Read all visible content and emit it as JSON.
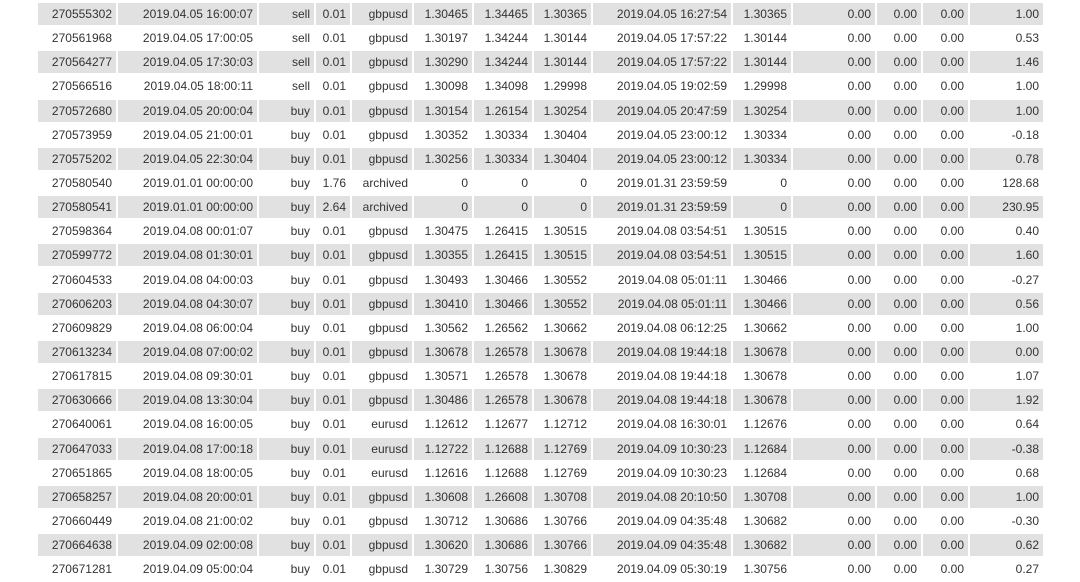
{
  "colors": {
    "alt_row": "#e1e1e1",
    "text": "#333333"
  },
  "rows": [
    [
      "270555302",
      "2019.04.05 16:00:07",
      "sell",
      "0.01",
      "gbpusd",
      "1.30465",
      "1.34465",
      "1.30365",
      "2019.04.05 16:27:54",
      "1.30365",
      "0.00",
      "0.00",
      "0.00",
      "1.00"
    ],
    [
      "270561968",
      "2019.04.05 17:00:05",
      "sell",
      "0.01",
      "gbpusd",
      "1.30197",
      "1.34244",
      "1.30144",
      "2019.04.05 17:57:22",
      "1.30144",
      "0.00",
      "0.00",
      "0.00",
      "0.53"
    ],
    [
      "270564277",
      "2019.04.05 17:30:03",
      "sell",
      "0.01",
      "gbpusd",
      "1.30290",
      "1.34244",
      "1.30144",
      "2019.04.05 17:57:22",
      "1.30144",
      "0.00",
      "0.00",
      "0.00",
      "1.46"
    ],
    [
      "270566516",
      "2019.04.05 18:00:11",
      "sell",
      "0.01",
      "gbpusd",
      "1.30098",
      "1.34098",
      "1.29998",
      "2019.04.05 19:02:59",
      "1.29998",
      "0.00",
      "0.00",
      "0.00",
      "1.00"
    ],
    [
      "270572680",
      "2019.04.05 20:00:04",
      "buy",
      "0.01",
      "gbpusd",
      "1.30154",
      "1.26154",
      "1.30254",
      "2019.04.05 20:47:59",
      "1.30254",
      "0.00",
      "0.00",
      "0.00",
      "1.00"
    ],
    [
      "270573959",
      "2019.04.05 21:00:01",
      "buy",
      "0.01",
      "gbpusd",
      "1.30352",
      "1.30334",
      "1.30404",
      "2019.04.05 23:00:12",
      "1.30334",
      "0.00",
      "0.00",
      "0.00",
      "-0.18"
    ],
    [
      "270575202",
      "2019.04.05 22:30:04",
      "buy",
      "0.01",
      "gbpusd",
      "1.30256",
      "1.30334",
      "1.30404",
      "2019.04.05 23:00:12",
      "1.30334",
      "0.00",
      "0.00",
      "0.00",
      "0.78"
    ],
    [
      "270580540",
      "2019.01.01 00:00:00",
      "buy",
      "1.76",
      "archived",
      "0",
      "0",
      "0",
      "2019.01.31 23:59:59",
      "0",
      "0.00",
      "0.00",
      "0.00",
      "128.68"
    ],
    [
      "270580541",
      "2019.01.01 00:00:00",
      "buy",
      "2.64",
      "archived",
      "0",
      "0",
      "0",
      "2019.01.31 23:59:59",
      "0",
      "0.00",
      "0.00",
      "0.00",
      "230.95"
    ],
    [
      "270598364",
      "2019.04.08 00:01:07",
      "buy",
      "0.01",
      "gbpusd",
      "1.30475",
      "1.26415",
      "1.30515",
      "2019.04.08 03:54:51",
      "1.30515",
      "0.00",
      "0.00",
      "0.00",
      "0.40"
    ],
    [
      "270599772",
      "2019.04.08 01:30:01",
      "buy",
      "0.01",
      "gbpusd",
      "1.30355",
      "1.26415",
      "1.30515",
      "2019.04.08 03:54:51",
      "1.30515",
      "0.00",
      "0.00",
      "0.00",
      "1.60"
    ],
    [
      "270604533",
      "2019.04.08 04:00:03",
      "buy",
      "0.01",
      "gbpusd",
      "1.30493",
      "1.30466",
      "1.30552",
      "2019.04.08 05:01:11",
      "1.30466",
      "0.00",
      "0.00",
      "0.00",
      "-0.27"
    ],
    [
      "270606203",
      "2019.04.08 04:30:07",
      "buy",
      "0.01",
      "gbpusd",
      "1.30410",
      "1.30466",
      "1.30552",
      "2019.04.08 05:01:11",
      "1.30466",
      "0.00",
      "0.00",
      "0.00",
      "0.56"
    ],
    [
      "270609829",
      "2019.04.08 06:00:04",
      "buy",
      "0.01",
      "gbpusd",
      "1.30562",
      "1.26562",
      "1.30662",
      "2019.04.08 06:12:25",
      "1.30662",
      "0.00",
      "0.00",
      "0.00",
      "1.00"
    ],
    [
      "270613234",
      "2019.04.08 07:00:02",
      "buy",
      "0.01",
      "gbpusd",
      "1.30678",
      "1.26578",
      "1.30678",
      "2019.04.08 19:44:18",
      "1.30678",
      "0.00",
      "0.00",
      "0.00",
      "0.00"
    ],
    [
      "270617815",
      "2019.04.08 09:30:01",
      "buy",
      "0.01",
      "gbpusd",
      "1.30571",
      "1.26578",
      "1.30678",
      "2019.04.08 19:44:18",
      "1.30678",
      "0.00",
      "0.00",
      "0.00",
      "1.07"
    ],
    [
      "270630666",
      "2019.04.08 13:30:04",
      "buy",
      "0.01",
      "gbpusd",
      "1.30486",
      "1.26578",
      "1.30678",
      "2019.04.08 19:44:18",
      "1.30678",
      "0.00",
      "0.00",
      "0.00",
      "1.92"
    ],
    [
      "270640061",
      "2019.04.08 16:00:05",
      "buy",
      "0.01",
      "eurusd",
      "1.12612",
      "1.12677",
      "1.12712",
      "2019.04.08 16:30:01",
      "1.12676",
      "0.00",
      "0.00",
      "0.00",
      "0.64"
    ],
    [
      "270647033",
      "2019.04.08 17:00:18",
      "buy",
      "0.01",
      "eurusd",
      "1.12722",
      "1.12688",
      "1.12769",
      "2019.04.09 10:30:23",
      "1.12684",
      "0.00",
      "0.00",
      "0.00",
      "-0.38"
    ],
    [
      "270651865",
      "2019.04.08 18:00:05",
      "buy",
      "0.01",
      "eurusd",
      "1.12616",
      "1.12688",
      "1.12769",
      "2019.04.09 10:30:23",
      "1.12684",
      "0.00",
      "0.00",
      "0.00",
      "0.68"
    ],
    [
      "270658257",
      "2019.04.08 20:00:01",
      "buy",
      "0.01",
      "gbpusd",
      "1.30608",
      "1.26608",
      "1.30708",
      "2019.04.08 20:10:50",
      "1.30708",
      "0.00",
      "0.00",
      "0.00",
      "1.00"
    ],
    [
      "270660449",
      "2019.04.08 21:00:02",
      "buy",
      "0.01",
      "gbpusd",
      "1.30712",
      "1.30686",
      "1.30766",
      "2019.04.09 04:35:48",
      "1.30682",
      "0.00",
      "0.00",
      "0.00",
      "-0.30"
    ],
    [
      "270664638",
      "2019.04.09 02:00:08",
      "buy",
      "0.01",
      "gbpusd",
      "1.30620",
      "1.30686",
      "1.30766",
      "2019.04.09 04:35:48",
      "1.30682",
      "0.00",
      "0.00",
      "0.00",
      "0.62"
    ],
    [
      "270671281",
      "2019.04.09 05:00:04",
      "buy",
      "0.01",
      "gbpusd",
      "1.30729",
      "1.30756",
      "1.30829",
      "2019.04.09 05:30:19",
      "1.30756",
      "0.00",
      "0.00",
      "0.00",
      "0.27"
    ]
  ]
}
